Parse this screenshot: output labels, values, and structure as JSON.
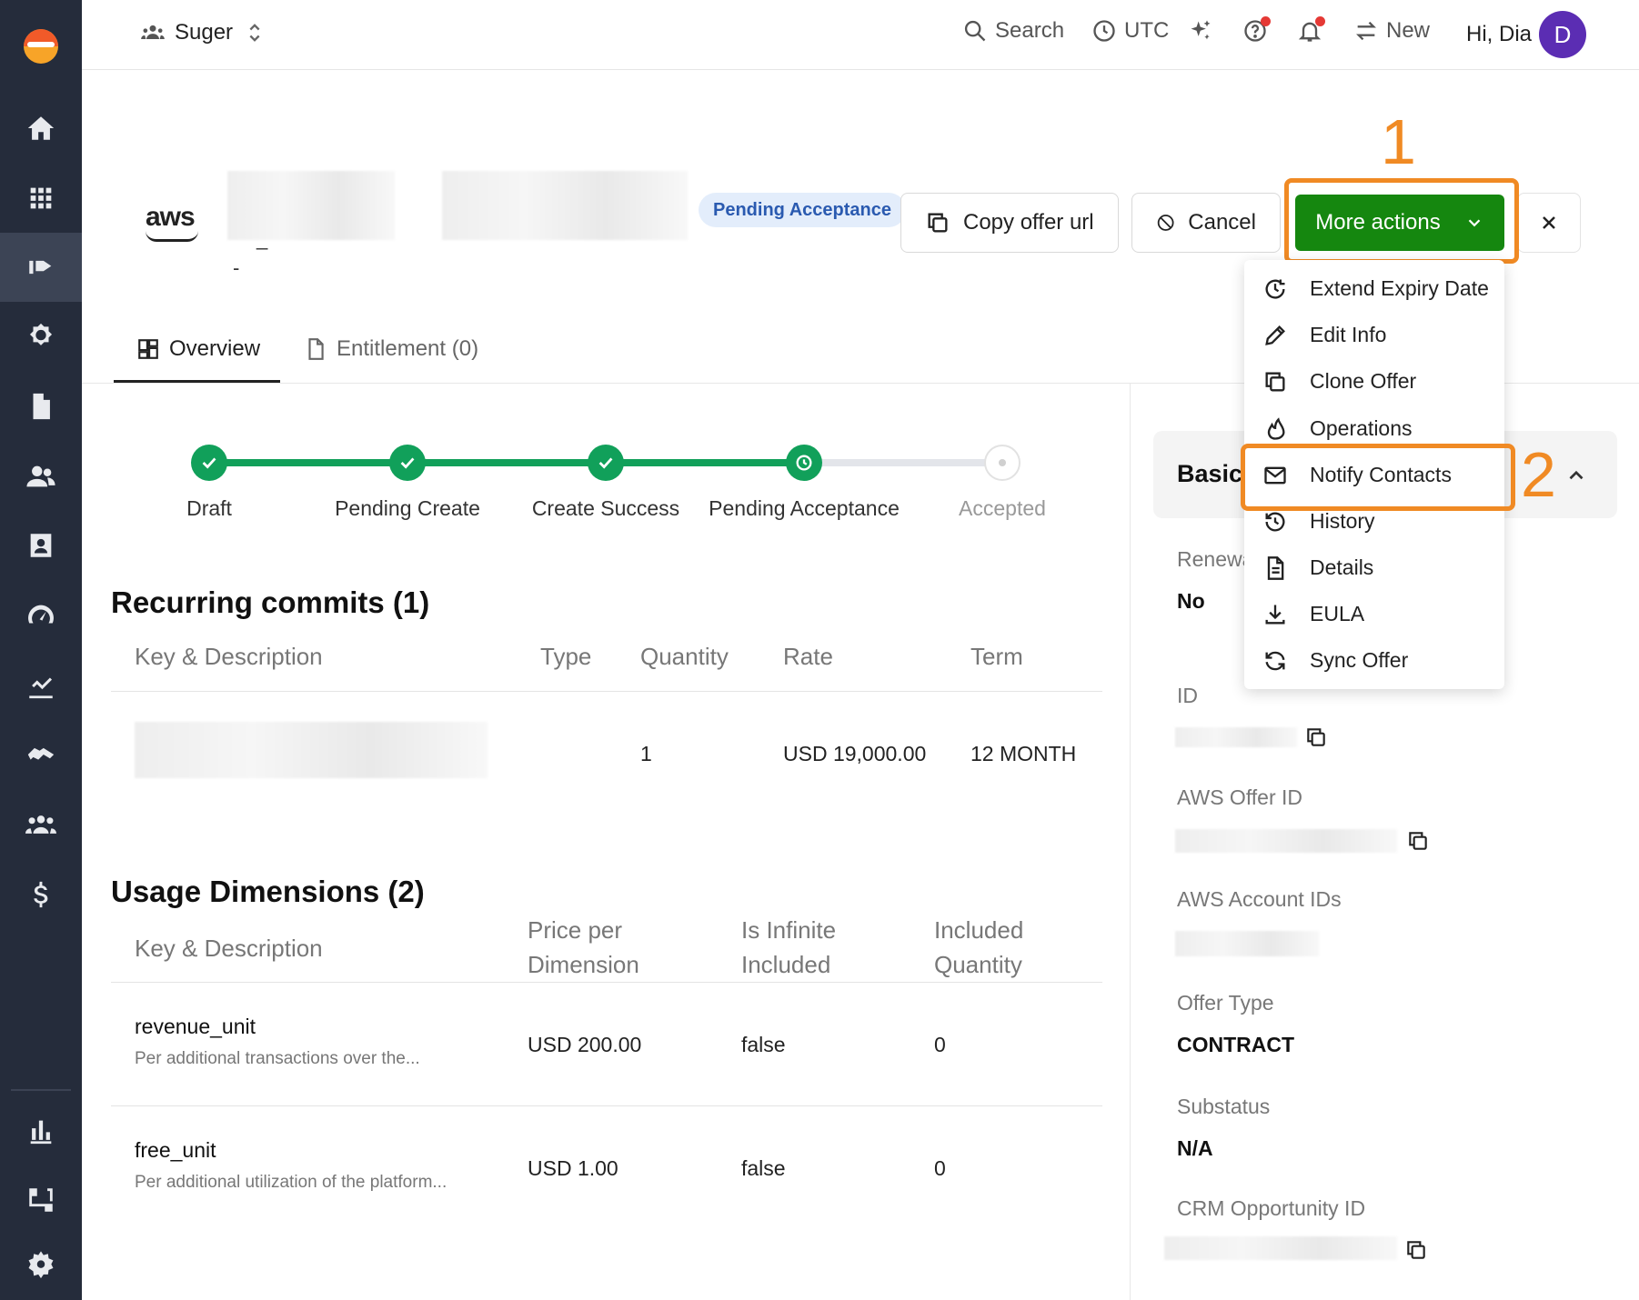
{
  "topbar": {
    "org_name": "Suger",
    "search_label": "Search",
    "timezone_label": "UTC",
    "new_label": "New",
    "greeting": "Hi, Dia",
    "avatar_initial": "D"
  },
  "header": {
    "provider_logo": "aws",
    "offer_subtitle": "-",
    "status_badge": "Pending Acceptance",
    "copy_url_label": "Copy offer url",
    "cancel_label": "Cancel",
    "more_actions_label": "More actions"
  },
  "annotations": {
    "step1": "1",
    "step2": "2",
    "color": "#f08a24"
  },
  "tabs": [
    {
      "label": "Overview",
      "active": true
    },
    {
      "label": "Entitlement (0)",
      "active": false
    }
  ],
  "progress_steps": [
    {
      "label": "Draft",
      "state": "done"
    },
    {
      "label": "Pending Create",
      "state": "done"
    },
    {
      "label": "Create Success",
      "state": "done"
    },
    {
      "label": "Pending Acceptance",
      "state": "current"
    },
    {
      "label": "Accepted",
      "state": "todo"
    }
  ],
  "recurring": {
    "title": "Recurring commits (1)",
    "columns": [
      "Key & Description",
      "Type",
      "Quantity",
      "Rate",
      "Term"
    ],
    "rows": [
      {
        "key": "",
        "type": "",
        "quantity": "1",
        "rate": "USD 19,000.00",
        "term": "12 MONTH"
      }
    ]
  },
  "usage": {
    "title": "Usage Dimensions (2)",
    "columns": [
      "Key & Description",
      "Price per Dimension",
      "Is Infinite Included",
      "Included Quantity"
    ],
    "rows": [
      {
        "name": "revenue_unit",
        "desc": "Per additional transactions over the...",
        "price": "USD 200.00",
        "infinite": "false",
        "included": "0"
      },
      {
        "name": "free_unit",
        "desc": "Per additional utilization of the platform...",
        "price": "USD 1.00",
        "infinite": "false",
        "included": "0"
      }
    ]
  },
  "panel": {
    "basic_title": "Basic",
    "renewal_label": "Renewal",
    "renewal_value": "No",
    "id_label": "ID",
    "aws_offer_id_label": "AWS Offer ID",
    "aws_account_ids_label": "AWS Account IDs",
    "offer_type_label": "Offer Type",
    "offer_type_value": "CONTRACT",
    "substatus_label": "Substatus",
    "substatus_value": "N/A",
    "crm_label": "CRM Opportunity ID"
  },
  "menu": {
    "items": [
      {
        "label": "Extend Expiry Date",
        "icon": "clock-arrow-icon"
      },
      {
        "label": "Edit Info",
        "icon": "pencil-icon"
      },
      {
        "label": "Clone Offer",
        "icon": "copy-icon"
      },
      {
        "label": "Operations",
        "icon": "flame-icon"
      },
      {
        "label": "Notify Contacts",
        "icon": "mail-icon"
      },
      {
        "label": "History",
        "icon": "history-icon"
      },
      {
        "label": "Details",
        "icon": "document-icon"
      },
      {
        "label": "EULA",
        "icon": "download-icon"
      },
      {
        "label": "Sync Offer",
        "icon": "sync-icon"
      }
    ]
  },
  "colors": {
    "sidebar": "#252c3b",
    "primary": "#15870f",
    "step_done": "#11a05a",
    "badge_bg": "#e3edfb",
    "badge_text": "#2a5ab0",
    "avatar": "#5b2db3"
  }
}
